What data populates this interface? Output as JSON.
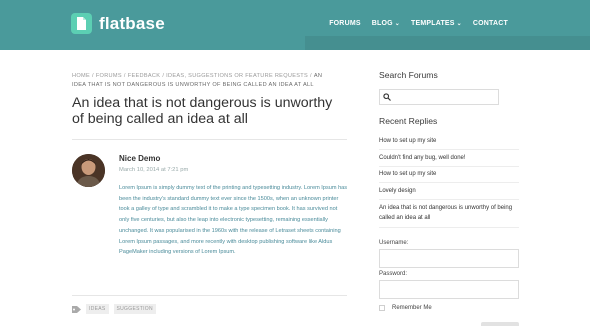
{
  "header": {
    "logo_text": "flatbase",
    "nav": [
      {
        "label": "FORUMS",
        "has_dropdown": false
      },
      {
        "label": "BLOG",
        "has_dropdown": true
      },
      {
        "label": "TEMPLATES",
        "has_dropdown": true
      },
      {
        "label": "CONTACT",
        "has_dropdown": false
      }
    ]
  },
  "breadcrumb": {
    "items": [
      "HOME",
      "FORUMS",
      "FEEDBACK",
      "IDEAS, SUGGESTIONS OR FEATURE REQUESTS"
    ],
    "current": "AN IDEA THAT IS NOT DANGEROUS IS UNWORTHY OF BEING CALLED AN IDEA AT ALL",
    "separator": "/"
  },
  "post": {
    "title": "An idea that is not dangerous is unworthy of being called an idea at all",
    "author": "Nice Demo",
    "date": "March 10, 2014 at 7:21 pm",
    "body": "Lorem Ipsum is simply dummy text of the printing and typesetting industry. Lorem Ipsum has been the industry's standard dummy text ever since the 1500s, when an unknown printer took a galley of type and scrambled it to make a type specimen book. It has survived not only five centuries, but also the leap into electronic typesetting, remaining essentially unchanged. It was popularised in the 1960s with the release of Letraset sheets containing Lorem Ipsum passages, and more recently with desktop publishing software like Aldus PageMaker including versions of Lorem Ipsum.",
    "tags": [
      "IDEAS",
      "SUGGESTION"
    ]
  },
  "sidebar": {
    "search_heading": "Search Forums",
    "search_placeholder": "",
    "replies_heading": "Recent Replies",
    "replies": [
      "How to set up my site",
      "Couldn't find any bug, well done!",
      "How to set up my site",
      "Lovely design",
      "An idea that is not dangerous is unworthy of being called an idea at all"
    ],
    "username_label": "Username:",
    "password_label": "Password:",
    "remember_label": "Remember Me"
  },
  "colors": {
    "header_bg": "#4a9a9b",
    "logo_accent": "#5ccfb3",
    "body_link": "#4a8b9a"
  }
}
